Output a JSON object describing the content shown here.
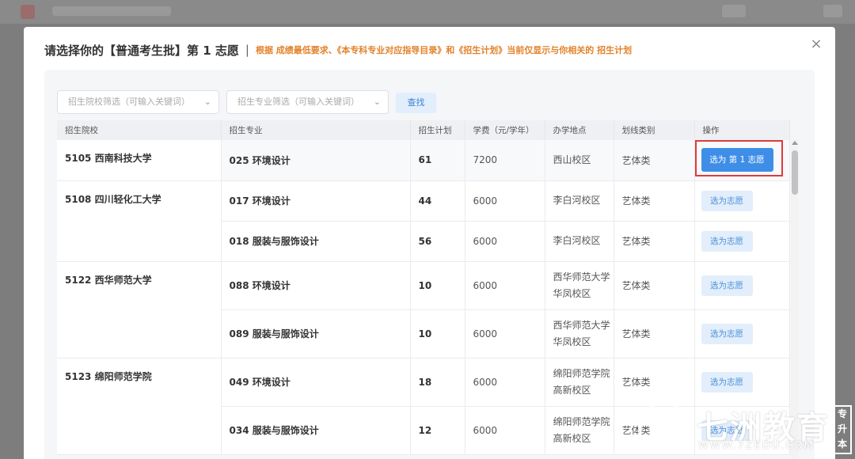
{
  "modal": {
    "title": "请选择你的【普通考生批】第 1 志愿",
    "separator": "|",
    "note": "根据 成绩最低要求、《本专科专业对应指导目录》和《招生计划》当前仅显示与你相关的 招生计划",
    "close_glyph": "×"
  },
  "filters": {
    "school_placeholder": "招生院校筛选（可输入关键词）",
    "major_placeholder": "招生专业筛选（可输入关键词）",
    "search_label": "查找"
  },
  "table": {
    "headers": [
      "招生院校",
      "招生专业",
      "招生计划",
      "学费（元/学年）",
      "办学地点",
      "划线类别",
      "操作"
    ],
    "rows": [
      {
        "school": "5105 西南科技大学",
        "major": "025 环境设计",
        "plan": "61",
        "fee": "7200",
        "location": "西山校区",
        "category": "艺体类",
        "action": "选为 第 1 志愿"
      },
      {
        "school": "5108 四川轻化工大学",
        "major": "017 环境设计",
        "plan": "44",
        "fee": "6000",
        "location": "李白河校区",
        "category": "艺体类",
        "action": "选为志愿"
      },
      {
        "school": "",
        "major": "018 服装与服饰设计",
        "plan": "56",
        "fee": "6000",
        "location": "李白河校区",
        "category": "艺体类",
        "action": "选为志愿"
      },
      {
        "school": "5122 西华师范大学",
        "major": "088 环境设计",
        "plan": "10",
        "fee": "6000",
        "location": "西华师范大学华凤校区",
        "category": "艺体类",
        "action": "选为志愿"
      },
      {
        "school": "",
        "major": "089 服装与服饰设计",
        "plan": "10",
        "fee": "6000",
        "location": "西华师范大学华凤校区",
        "category": "艺体类",
        "action": "选为志愿"
      },
      {
        "school": "5123 绵阳师范学院",
        "major": "049 环境设计",
        "plan": "18",
        "fee": "6000",
        "location": "绵阳师范学院高新校区",
        "category": "艺体类",
        "action": "选为志愿"
      },
      {
        "school": "",
        "major": "034 服装与服饰设计",
        "plan": "12",
        "fee": "6000",
        "location": "绵阳师范学院高新校区",
        "category": "艺体类",
        "action": "选为志愿"
      }
    ]
  },
  "watermark": {
    "name": "七洲教育",
    "url": "WWW.7ZEDU.COM",
    "tag": "专升本"
  },
  "colors": {
    "accent": "#3e8ee8",
    "note": "#e2822a",
    "highlight": "#e03a3a"
  }
}
